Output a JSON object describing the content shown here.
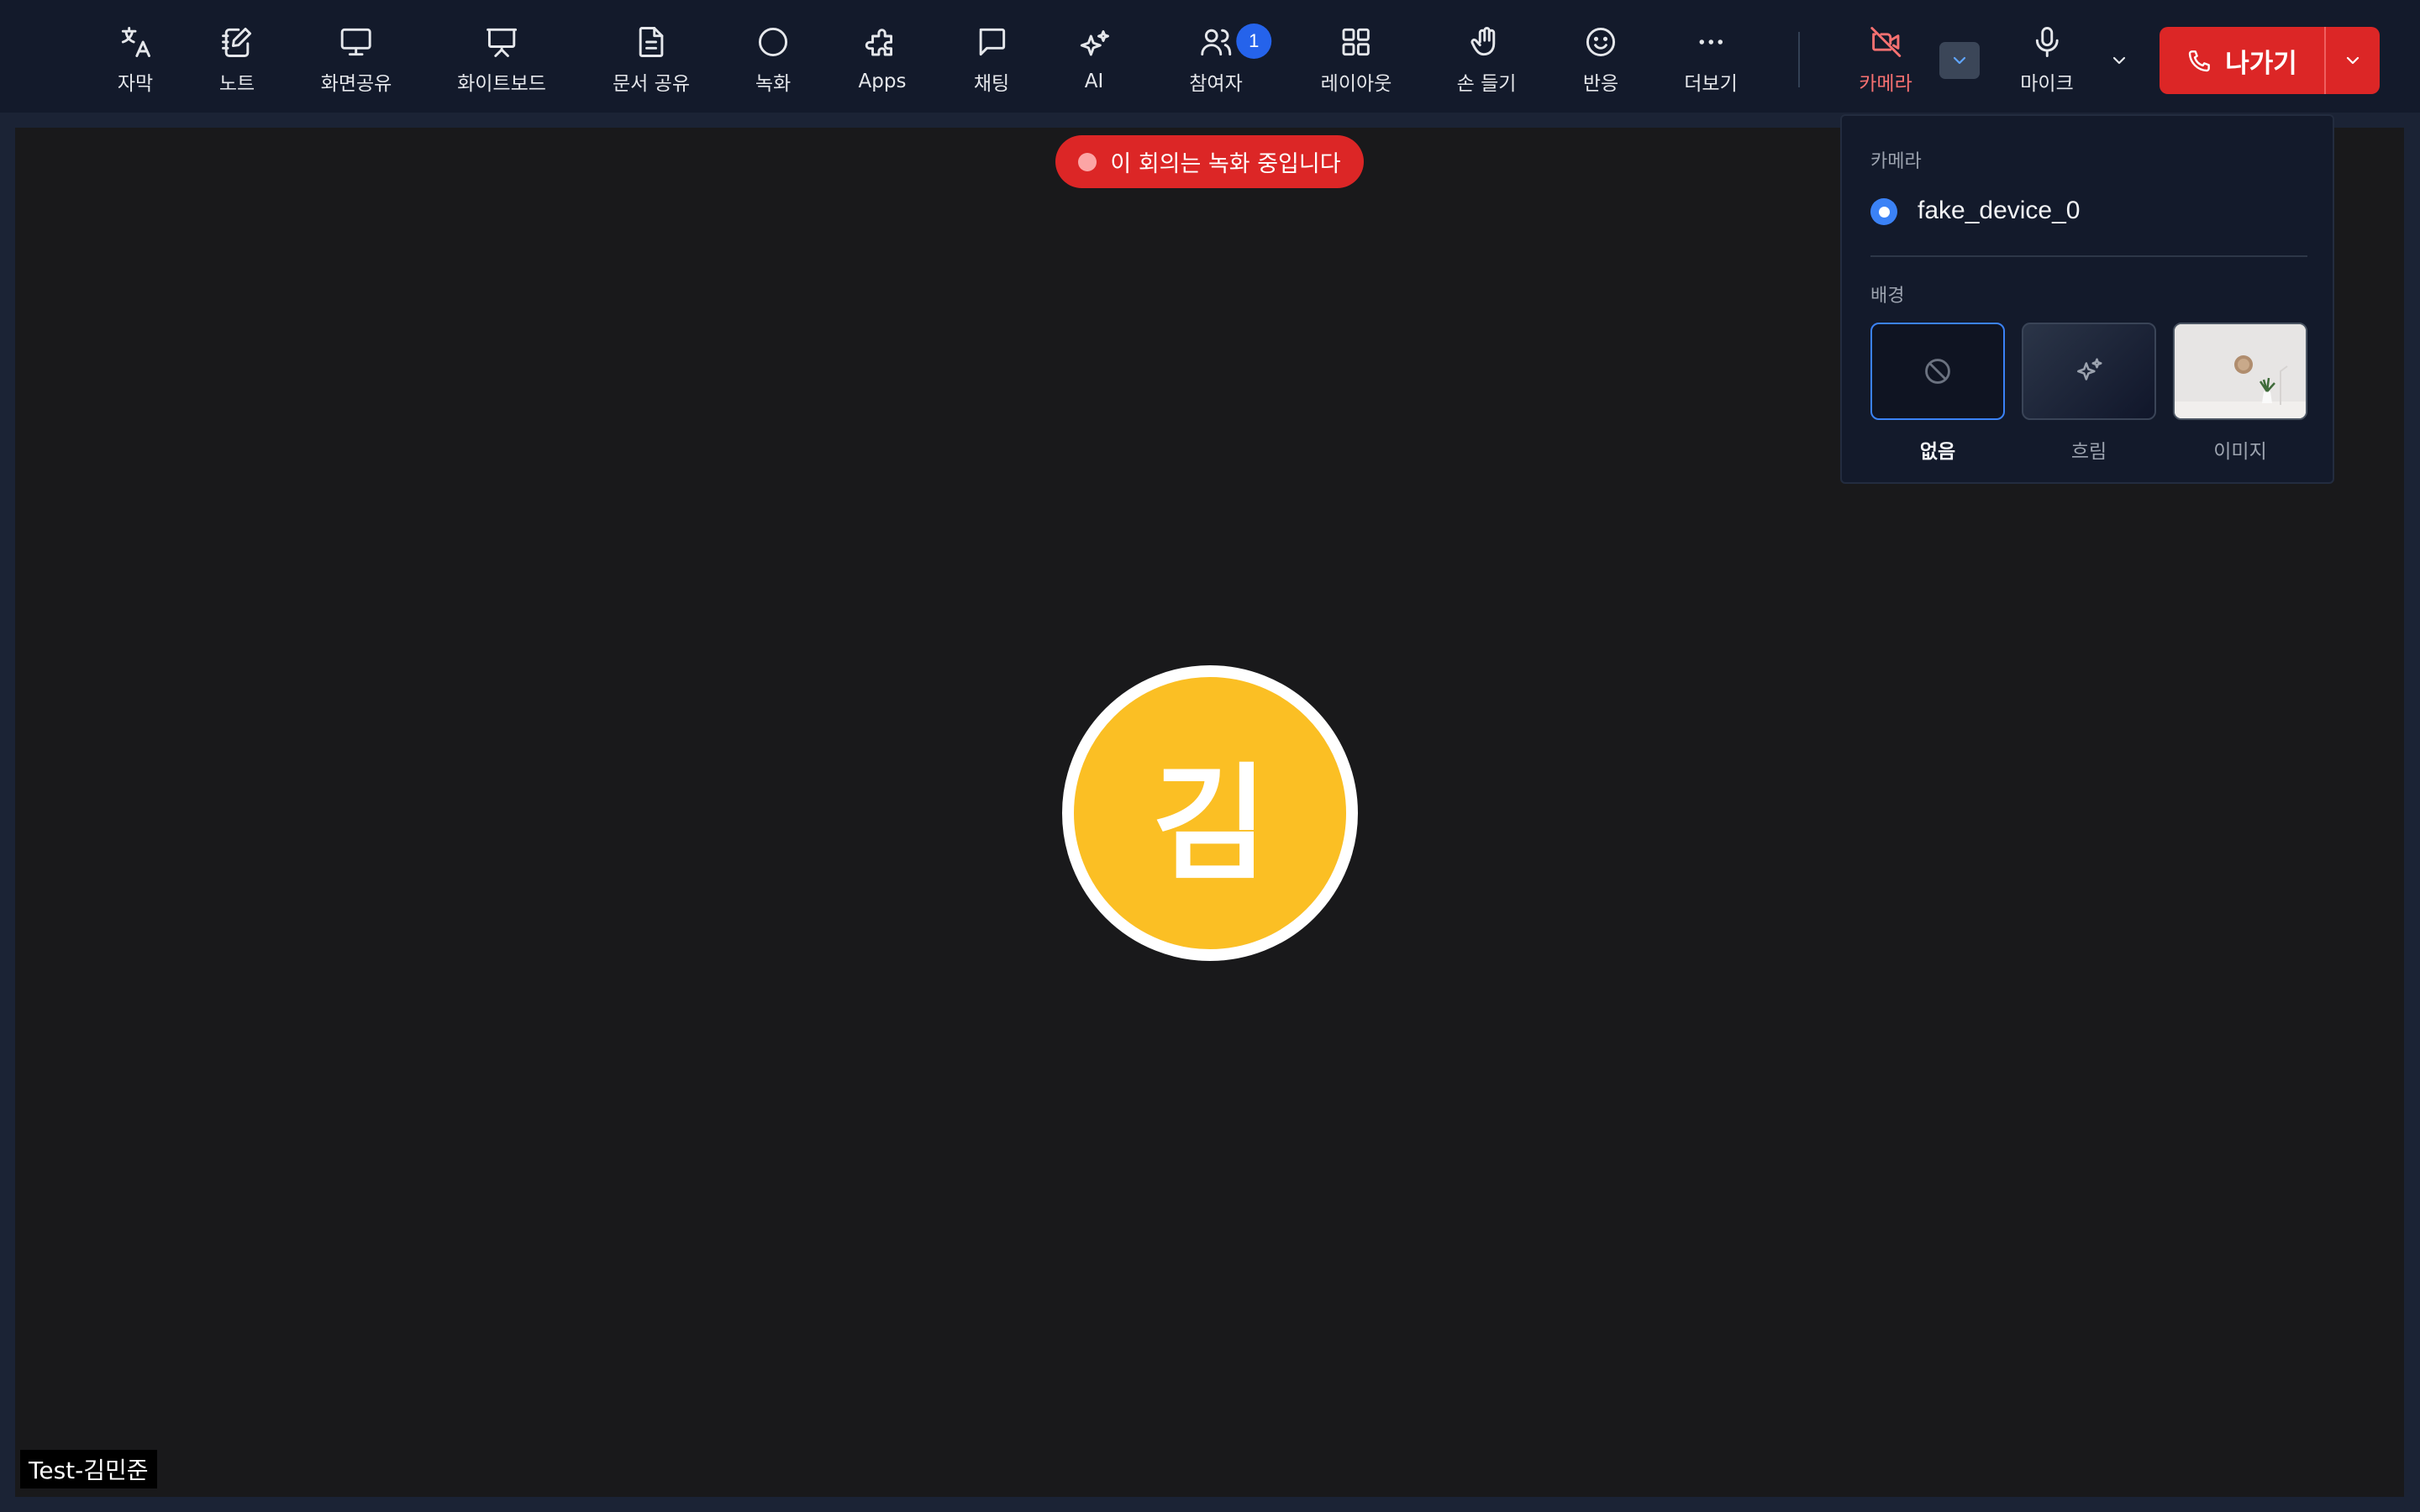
{
  "toolbar": {
    "items": [
      {
        "label": "자막",
        "icon": "translate-icon"
      },
      {
        "label": "노트",
        "icon": "notebook-icon"
      },
      {
        "label": "화면공유",
        "icon": "monitor-icon"
      },
      {
        "label": "화이트보드",
        "icon": "presentation-icon"
      },
      {
        "label": "문서 공유",
        "icon": "document-icon"
      },
      {
        "label": "녹화",
        "icon": "record-icon"
      },
      {
        "label": "Apps",
        "icon": "puzzle-icon"
      },
      {
        "label": "채팅",
        "icon": "chat-icon"
      },
      {
        "label": "AI",
        "icon": "sparkles-icon"
      },
      {
        "label": "참여자",
        "icon": "users-icon"
      },
      {
        "label": "레이아웃",
        "icon": "grid-icon"
      },
      {
        "label": "손 들기",
        "icon": "hand-icon"
      },
      {
        "label": "반응",
        "icon": "smile-icon"
      },
      {
        "label": "더보기",
        "icon": "more-icon"
      }
    ],
    "participants_count": "1",
    "camera_label": "카메라",
    "mic_label": "마이크",
    "leave_label": "나가기"
  },
  "recording_banner": "이 회의는 녹화 중입니다",
  "avatar_initial": "김",
  "participant_name": "Test-김민준",
  "camera_panel": {
    "camera_section": "카메라",
    "device": "fake_device_0",
    "background_section": "배경",
    "options": [
      {
        "label": "없음",
        "selected": true
      },
      {
        "label": "흐림",
        "selected": false
      },
      {
        "label": "이미지",
        "selected": false
      }
    ]
  },
  "colors": {
    "accent": "#3b82f6",
    "danger": "#dc2626",
    "avatar": "#fbbf24",
    "camera_off": "#f87171"
  }
}
